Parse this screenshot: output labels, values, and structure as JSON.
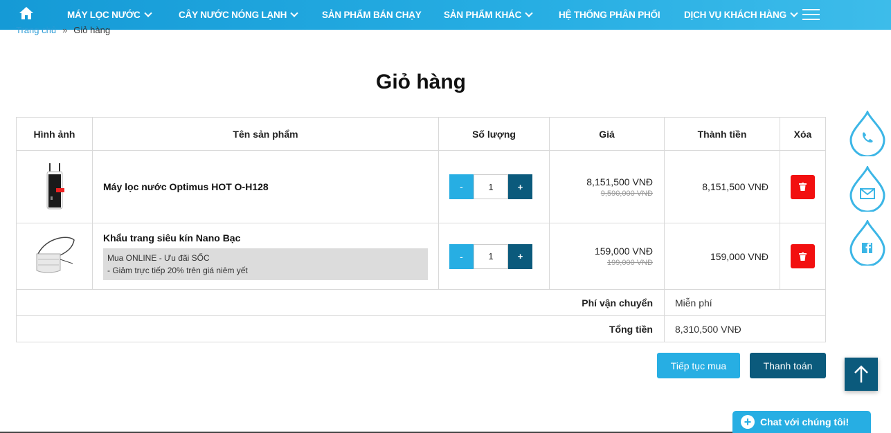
{
  "nav": {
    "items": [
      {
        "label": "MÁY LỌC NƯỚC",
        "dropdown": true
      },
      {
        "label": "CÂY NƯỚC NÓNG LẠNH",
        "dropdown": true
      },
      {
        "label": "SẢN PHẨM BÁN CHẠY",
        "dropdown": false
      },
      {
        "label": "SẢN PHẨM KHÁC",
        "dropdown": true
      },
      {
        "label": "HỆ THỐNG PHÂN PHỐI",
        "dropdown": false
      },
      {
        "label": "DỊCH VỤ KHÁCH HÀNG",
        "dropdown": true
      }
    ]
  },
  "breadcrumb": {
    "home": "Trang chủ",
    "sep": "»",
    "current": "Giỏ hàng"
  },
  "page_title": "Giỏ hàng",
  "table": {
    "headers": {
      "image": "Hình ảnh",
      "name": "Tên sản phẩm",
      "qty": "Số lượng",
      "price": "Giá",
      "total": "Thành tiền",
      "delete": "Xóa"
    },
    "rows": [
      {
        "name": "Máy lọc nước Optimus HOT O-H128",
        "promo": null,
        "qty": "1",
        "price": "8,151,500 VNĐ",
        "old_price": "9,590,000 VNĐ",
        "total": "8,151,500 VNĐ"
      },
      {
        "name": "Khẩu trang siêu kín Nano Bạc",
        "promo_line1": "Mua ONLINE - Ưu đãi SỐC",
        "promo_line2": "- Giảm trực tiếp 20% trên giá niêm yết",
        "qty": "1",
        "price": "159,000 VNĐ",
        "old_price": "199,000 VNĐ",
        "total": "159,000 VNĐ"
      }
    ],
    "minus": "-",
    "plus": "+",
    "shipping_label": "Phí vận chuyển",
    "shipping_value": "Miễn phí",
    "sum_label": "Tổng tiền",
    "sum_value": "8,310,500 VNĐ"
  },
  "buttons": {
    "continue": "Tiếp tục mua",
    "pay": "Thanh toán"
  },
  "chat": {
    "label": "Chat với chúng tôi!"
  },
  "colors": {
    "nav": "#159ad6",
    "accent": "#27aee3",
    "dark": "#0b5a7c",
    "delete": "#f20f0f"
  },
  "icons": [
    "home-icon",
    "hamburger-icon",
    "trash-icon",
    "phone-icon",
    "mail-icon",
    "facebook-icon",
    "arrow-up-icon",
    "plus-icon"
  ]
}
